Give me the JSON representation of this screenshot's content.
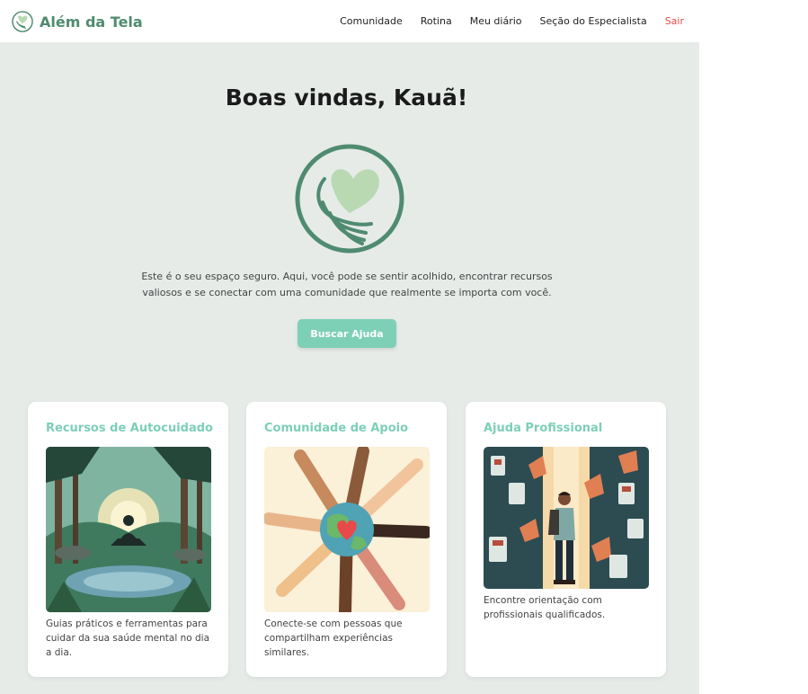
{
  "brand": {
    "name": "Além da Tela",
    "logo_icon": "heart-hands-logo-icon"
  },
  "nav": {
    "items": [
      {
        "label": "Comunidade"
      },
      {
        "label": "Rotina"
      },
      {
        "label": "Meu diário"
      },
      {
        "label": "Seção do Especialista"
      }
    ],
    "logout": "Sair"
  },
  "hero": {
    "title": "Boas vindas, Kauã!",
    "logo_icon": "heart-hands-logo-icon",
    "description": "Este é o seu espaço seguro. Aqui, você pode se sentir acolhido, encontrar recursos valiosos e se conectar com uma comunidade que realmente se importa com você.",
    "button": "Buscar Ajuda"
  },
  "cards": [
    {
      "title": "Recursos de Autocuidado",
      "text": "Guias práticos e ferramentas para cuidar da sua saúde mental no dia a dia.",
      "image_icon": "meditation-forest-illustration"
    },
    {
      "title": "Comunidade de Apoio",
      "text": "Conecte-se com pessoas que compartilham experiências similares.",
      "image_icon": "hands-around-globe-illustration"
    },
    {
      "title": "Ajuda Profissional",
      "text": "Encontre orientação com profissionais qualificados.",
      "image_icon": "man-in-library-illustration"
    }
  ],
  "colors": {
    "brand": "#4f8b70",
    "accent": "#7dcfb6",
    "background": "#e6ebe8",
    "logout": "#e24b4b"
  }
}
